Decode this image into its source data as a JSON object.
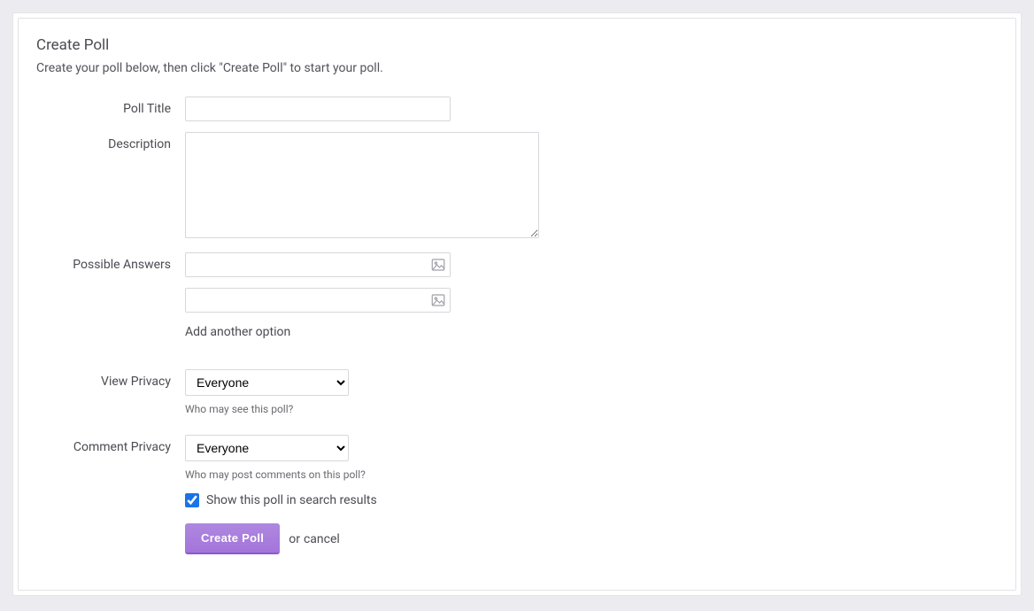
{
  "header": {
    "title": "Create Poll",
    "subtitle": "Create your poll below, then click \"Create Poll\" to start your poll."
  },
  "fields": {
    "poll_title_label": "Poll Title",
    "poll_title_value": "",
    "description_label": "Description",
    "description_value": "",
    "possible_answers_label": "Possible Answers",
    "answer1_value": "",
    "answer2_value": "",
    "add_option_label": "Add another option",
    "view_privacy_label": "View Privacy",
    "view_privacy_selected": "Everyone",
    "view_privacy_help": "Who may see this poll?",
    "comment_privacy_label": "Comment Privacy",
    "comment_privacy_selected": "Everyone",
    "comment_privacy_help": "Who may post comments on this poll?",
    "search_checkbox_label": "Show this poll in search results"
  },
  "actions": {
    "submit_label": "Create Poll",
    "or_text": "or",
    "cancel_label": "cancel"
  }
}
